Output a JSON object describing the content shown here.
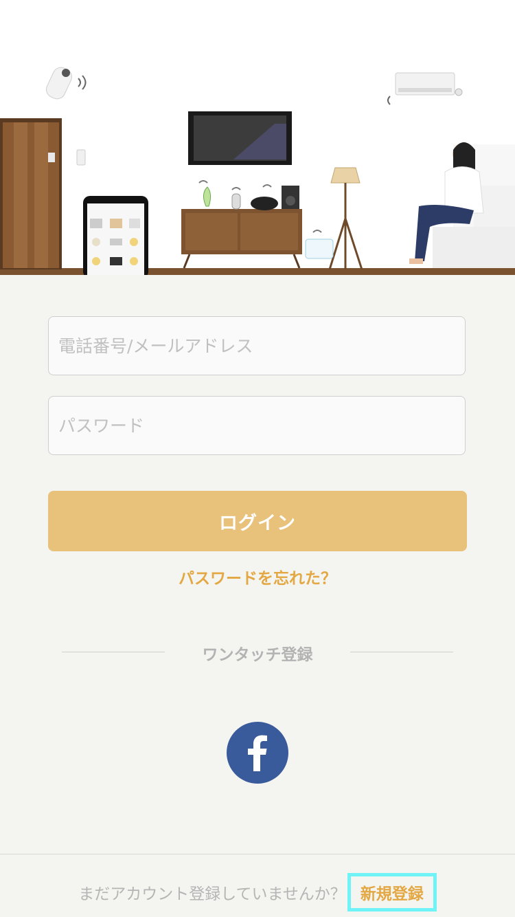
{
  "login_form": {
    "phone_email_placeholder": "電話番号/メールアドレス",
    "password_placeholder": "パスワード",
    "login_label": "ログイン",
    "forgot_password_label": "パスワードを忘れた？"
  },
  "one_touch": {
    "divider_label": "ワンタッチ登録",
    "facebook_icon": "facebook-icon"
  },
  "footer": {
    "prompt_text": "まだアカウント登録していませんか？",
    "register_label": "新規登録"
  },
  "colors": {
    "accent": "#e8c27b",
    "link": "#e3a843",
    "facebook": "#3a5b9b",
    "background": "#f4f4f0",
    "highlight": "#6ff3f7"
  }
}
